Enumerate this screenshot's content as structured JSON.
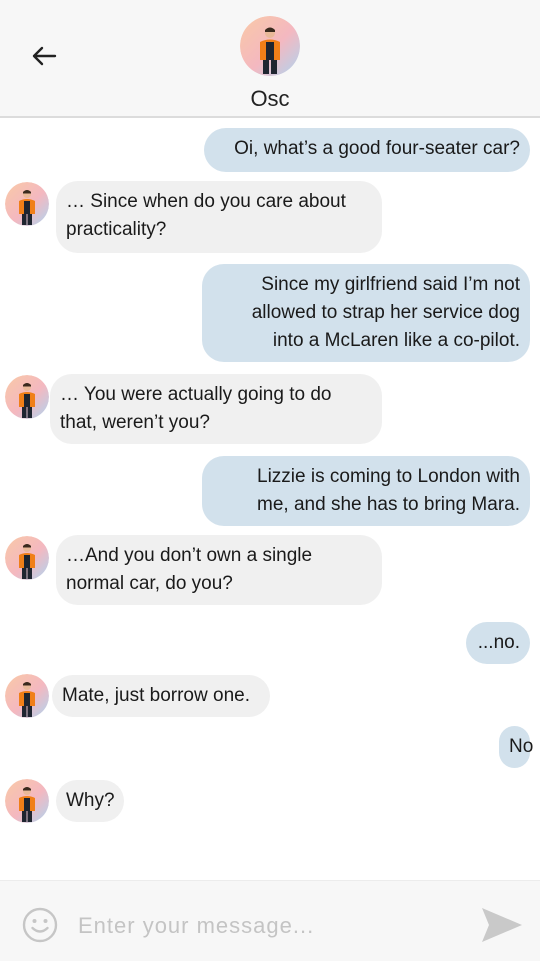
{
  "header": {
    "back_icon": "arrow-left-icon",
    "contact_name": "Osc",
    "avatar_icon": "contact-avatar"
  },
  "messages": [
    {
      "side": "out",
      "lines": [
        "Oi, what’s a good four-seater car?"
      ]
    },
    {
      "side": "in",
      "lines": [
        "… Since when do you care about",
        "practicality?"
      ]
    },
    {
      "side": "out",
      "lines": [
        "Since my girlfriend said I’m not",
        "allowed to strap her service dog",
        "into a McLaren like a co-pilot."
      ]
    },
    {
      "side": "in",
      "lines": [
        "… You were actually going to do",
        "that, weren’t you?"
      ]
    },
    {
      "side": "out",
      "lines": [
        "Lizzie is coming to London with",
        "me, and she has to bring Mara."
      ]
    },
    {
      "side": "in",
      "lines": [
        "…And you don’t own a single",
        "normal car, do you?"
      ]
    },
    {
      "side": "out",
      "lines": [
        "...no."
      ]
    },
    {
      "side": "in",
      "lines": [
        "Mate, just borrow one."
      ]
    },
    {
      "side": "out",
      "lines": [
        "No"
      ]
    },
    {
      "side": "in",
      "lines": [
        "Why?"
      ]
    }
  ],
  "composer": {
    "placeholder": "Enter your message...",
    "emoji_icon": "smiley-icon",
    "send_icon": "send-icon"
  },
  "colors": {
    "outgoing_bubble": "#d2e1ec",
    "incoming_bubble": "#f0f0f0",
    "header_bg": "#f7f7f7"
  }
}
